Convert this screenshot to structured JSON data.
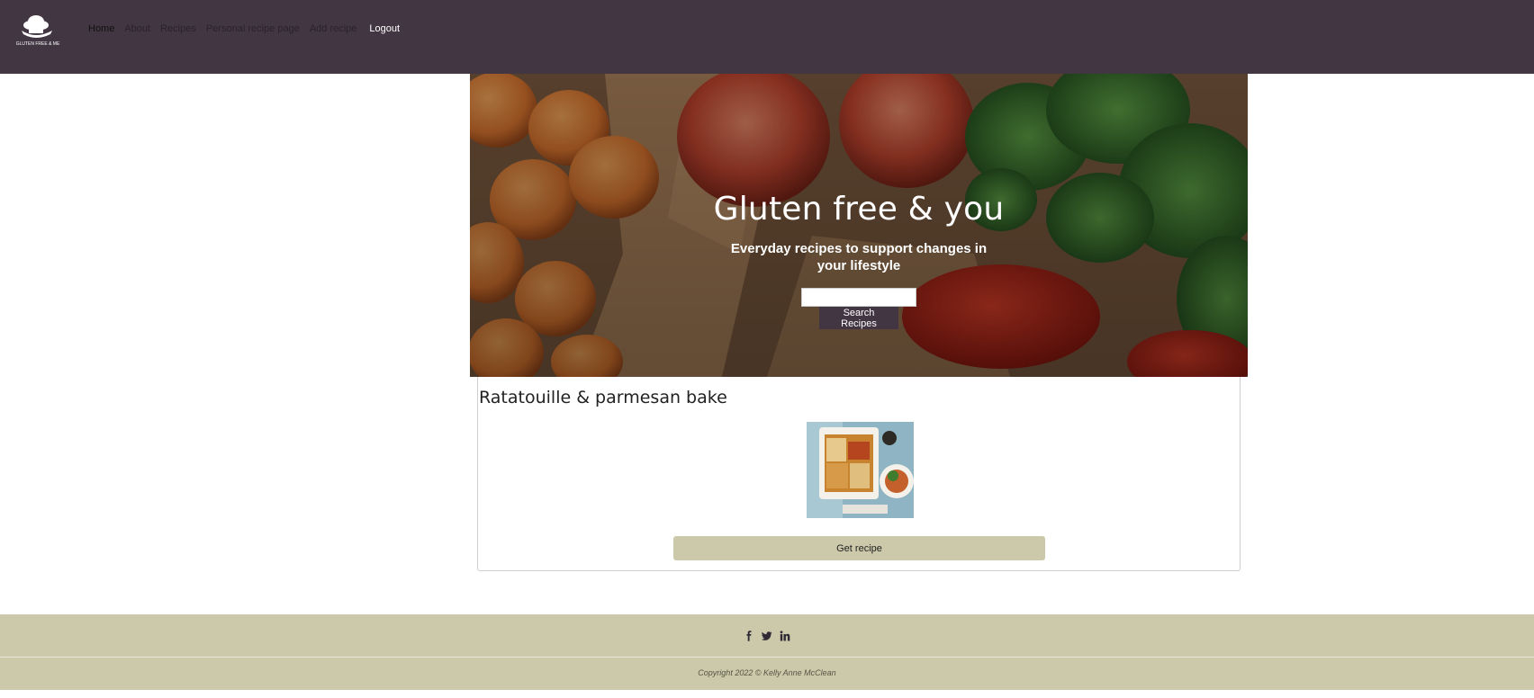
{
  "nav": {
    "logo_text": "GLUTEN FREE & ME",
    "items": [
      {
        "label": "Home"
      },
      {
        "label": "About"
      },
      {
        "label": "Recipes"
      },
      {
        "label": "Personal recipe page"
      },
      {
        "label": "Add recipe"
      }
    ],
    "logout_label": "Logout"
  },
  "hero": {
    "title": "Gluten free & you",
    "subtitle": "Everyday recipes to support changes in your lifestyle",
    "search_value": "",
    "search_button_label": "Search Recipes"
  },
  "recipe_card": {
    "title": "Ratatouille & parmesan bake",
    "image_alt": "Ratatouille & parmesan bake",
    "button_label": "Get recipe"
  },
  "footer": {
    "social_icons": [
      "facebook-icon",
      "twitter-icon",
      "linkedin-icon"
    ],
    "copyright": "Copyright 2022 © Kelly Anne McClean"
  },
  "colors": {
    "nav_bg": "#433643",
    "footer_bg": "#cbc9aa",
    "button_accent": "#cbc9aa",
    "search_button_bg": "#433643"
  }
}
